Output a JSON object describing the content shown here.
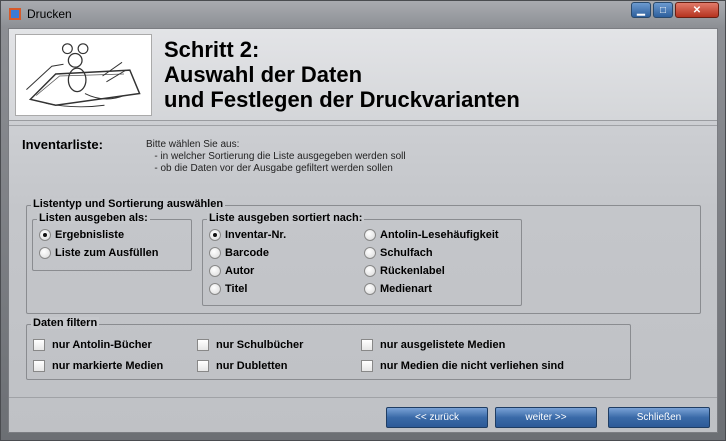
{
  "window": {
    "title": "Drucken"
  },
  "header": {
    "step_line1": "Schritt 2:",
    "step_line2": "Auswahl der Daten",
    "step_line3": "und Festlegen der Druckvarianten"
  },
  "inventory": {
    "label": "Inventarliste:",
    "desc_line1": "Bitte wählen Sie aus:",
    "desc_line2": "   - in welcher Sortierung die Liste ausgegeben werden soll",
    "desc_line3": "   - ob die Daten vor der Ausgabe gefiltert werden sollen"
  },
  "list_type": {
    "legend": "Listentyp und Sortierung auswählen",
    "output_group": {
      "legend": "Listen ausgeben als:",
      "options": [
        {
          "label": "Ergebnisliste",
          "selected": true
        },
        {
          "label": "Liste zum Ausfüllen",
          "selected": false
        }
      ]
    },
    "sort_group": {
      "legend": "Liste ausgeben sortiert nach:",
      "options": [
        {
          "label": "Inventar-Nr.",
          "selected": true
        },
        {
          "label": "Barcode",
          "selected": false
        },
        {
          "label": "Autor",
          "selected": false
        },
        {
          "label": "Titel",
          "selected": false
        },
        {
          "label": "Antolin-Lesehäufigkeit",
          "selected": false
        },
        {
          "label": "Schulfach",
          "selected": false
        },
        {
          "label": "Rückenlabel",
          "selected": false
        },
        {
          "label": "Medienart",
          "selected": false
        }
      ]
    }
  },
  "filter": {
    "legend": "Daten filtern",
    "options": [
      {
        "label": "nur Antolin-Bücher",
        "checked": false
      },
      {
        "label": "nur markierte Medien",
        "checked": false
      },
      {
        "label": "nur Schulbücher",
        "checked": false
      },
      {
        "label": "nur Dubletten",
        "checked": false
      },
      {
        "label": "nur ausgelistete Medien",
        "checked": false
      },
      {
        "label": "nur Medien die nicht verliehen sind",
        "checked": false
      }
    ]
  },
  "buttons": {
    "back": "<< zurück",
    "next": "weiter >>",
    "close": "Schließen"
  }
}
